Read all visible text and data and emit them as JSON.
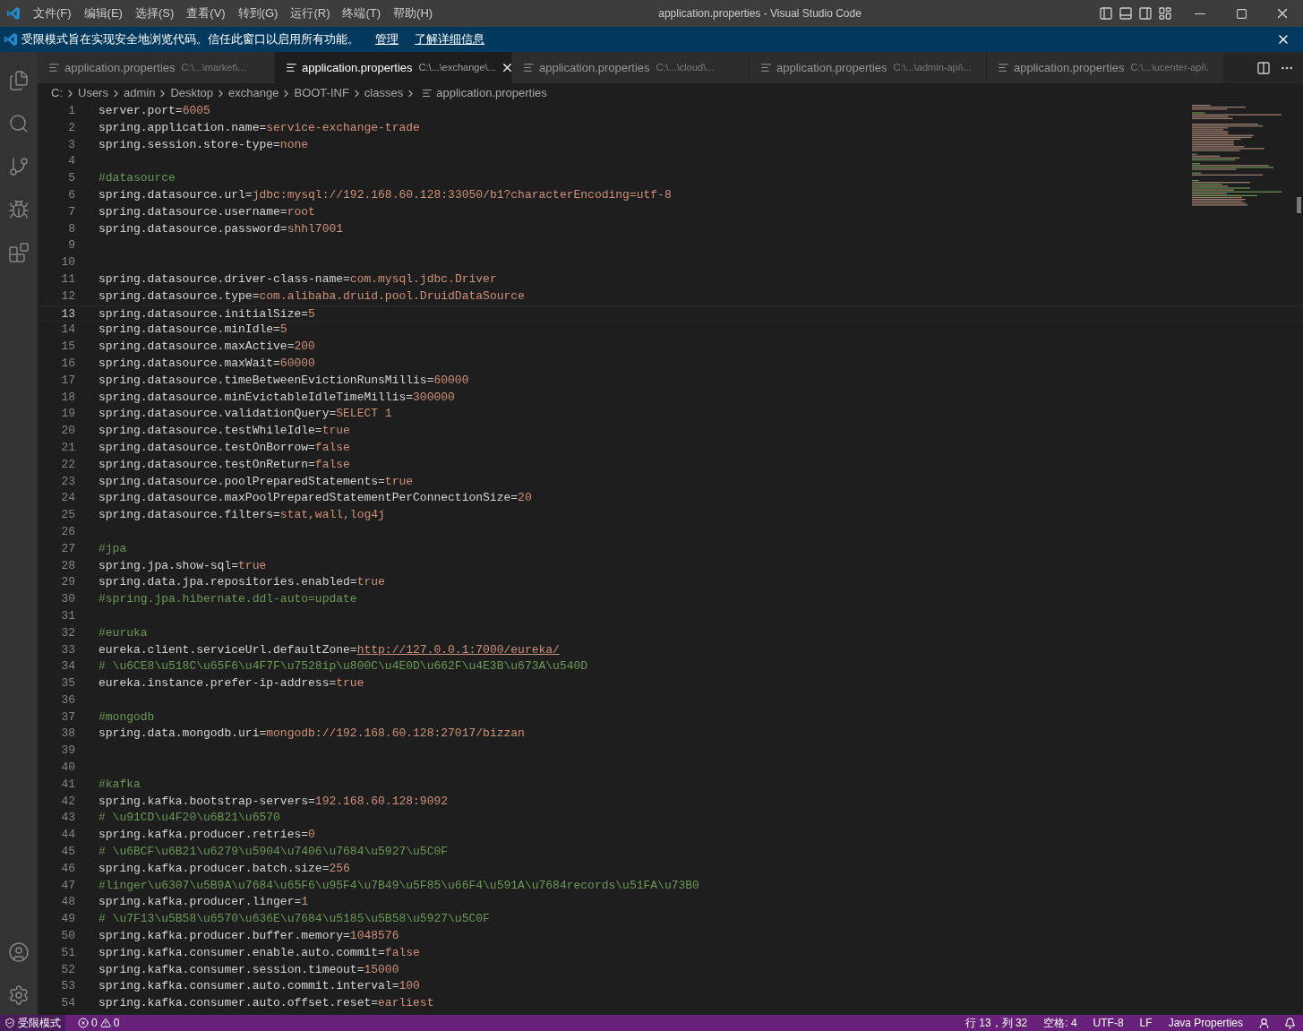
{
  "title_bar": {
    "menu": [
      "文件(F)",
      "编辑(E)",
      "选择(S)",
      "查看(V)",
      "转到(G)",
      "运行(R)",
      "终端(T)",
      "帮助(H)"
    ],
    "title": "application.properties - Visual Studio Code"
  },
  "banner": {
    "message": "受限模式旨在实现安全地浏览代码。信任此窗口以启用所有功能。",
    "links": [
      "管理",
      "了解详细信息"
    ]
  },
  "tabs": [
    {
      "label": "application.properties",
      "path": "C:\\...\\market\\...",
      "selected": false
    },
    {
      "label": "application.properties",
      "path": "C:\\...\\exchange\\...",
      "selected": true
    },
    {
      "label": "application.properties",
      "path": "C:\\...\\cloud\\...",
      "selected": false
    },
    {
      "label": "application.properties",
      "path": "C:\\...\\admin-api\\...",
      "selected": false
    },
    {
      "label": "application.properties",
      "path": "C:\\...\\ucenter-api\\.",
      "selected": false
    }
  ],
  "breadcrumb": [
    "C:",
    "Users",
    "admin",
    "Desktop",
    "exchange",
    "BOOT-INF",
    "classes",
    "application.properties"
  ],
  "editor": {
    "lines": [
      {
        "number": "1",
        "kind": "kv",
        "key": "server.port=",
        "value": "6005",
        "selected": false
      },
      {
        "number": "2",
        "kind": "kv",
        "key": "spring.application.name=",
        "value": "service-exchange-trade",
        "selected": false
      },
      {
        "number": "3",
        "kind": "kv",
        "key": "spring.session.store-type=",
        "value": "none",
        "selected": false
      },
      {
        "number": "4",
        "kind": "blank",
        "selected": false
      },
      {
        "number": "5",
        "kind": "comment",
        "text": "#datasource",
        "selected": false
      },
      {
        "number": "6",
        "kind": "kv",
        "key": "spring.datasource.url=",
        "value": "jdbc:mysql://192.168.60.128:33050/b1?characterEncoding=utf-8",
        "selected": false
      },
      {
        "number": "7",
        "kind": "kv",
        "key": "spring.datasource.username=",
        "value": "root",
        "selected": false
      },
      {
        "number": "8",
        "kind": "kv",
        "key": "spring.datasource.password=",
        "value": "shhl7001",
        "selected": false
      },
      {
        "number": "9",
        "kind": "blank",
        "selected": false
      },
      {
        "number": "10",
        "kind": "blank",
        "selected": false
      },
      {
        "number": "11",
        "kind": "kv",
        "key": "spring.datasource.driver-class-name=",
        "value": "com.mysql.jdbc.Driver",
        "selected": false
      },
      {
        "number": "12",
        "kind": "kv",
        "key": "spring.datasource.type=",
        "value": "com.alibaba.druid.pool.DruidDataSource",
        "selected": false
      },
      {
        "number": "13",
        "kind": "kv",
        "key": "spring.datasource.initialSize=",
        "value": "5",
        "selected": true
      },
      {
        "number": "14",
        "kind": "kv",
        "key": "spring.datasource.minIdle=",
        "value": "5",
        "selected": false
      },
      {
        "number": "15",
        "kind": "kv",
        "key": "spring.datasource.maxActive=",
        "value": "200",
        "selected": false
      },
      {
        "number": "16",
        "kind": "kv",
        "key": "spring.datasource.maxWait=",
        "value": "60000",
        "selected": false
      },
      {
        "number": "17",
        "kind": "kv",
        "key": "spring.datasource.timeBetweenEvictionRunsMillis=",
        "value": "60000",
        "selected": false
      },
      {
        "number": "18",
        "kind": "kv",
        "key": "spring.datasource.minEvictableIdleTimeMillis=",
        "value": "300000",
        "selected": false
      },
      {
        "number": "19",
        "kind": "kv",
        "key": "spring.datasource.validationQuery=",
        "value": "SELECT 1",
        "selected": false
      },
      {
        "number": "20",
        "kind": "kv",
        "key": "spring.datasource.testWhileIdle=",
        "value": "true",
        "selected": false
      },
      {
        "number": "21",
        "kind": "kv",
        "key": "spring.datasource.testOnBorrow=",
        "value": "false",
        "selected": false
      },
      {
        "number": "22",
        "kind": "kv",
        "key": "spring.datasource.testOnReturn=",
        "value": "false",
        "selected": false
      },
      {
        "number": "23",
        "kind": "kv",
        "key": "spring.datasource.poolPreparedStatements=",
        "value": "true",
        "selected": false
      },
      {
        "number": "24",
        "kind": "kv",
        "key": "spring.datasource.maxPoolPreparedStatementPerConnectionSize=",
        "value": "20",
        "selected": false
      },
      {
        "number": "25",
        "kind": "kv",
        "key": "spring.datasource.filters=",
        "value": "stat,wall,log4j",
        "selected": false
      },
      {
        "number": "26",
        "kind": "blank",
        "selected": false
      },
      {
        "number": "27",
        "kind": "comment",
        "text": "#jpa",
        "selected": false
      },
      {
        "number": "28",
        "kind": "kv",
        "key": "spring.jpa.show-sql=",
        "value": "true",
        "selected": false
      },
      {
        "number": "29",
        "kind": "kv",
        "key": "spring.data.jpa.repositories.enabled=",
        "value": "true",
        "selected": false
      },
      {
        "number": "30",
        "kind": "comment",
        "text": "#spring.jpa.hibernate.ddl-auto=update",
        "selected": false
      },
      {
        "number": "31",
        "kind": "blank",
        "selected": false
      },
      {
        "number": "32",
        "kind": "comment",
        "text": "#euruka",
        "selected": false
      },
      {
        "number": "33",
        "kind": "link",
        "key": "eureka.client.serviceUrl.defaultZone=",
        "value": "http://127.0.0.1:7000/eureka/",
        "selected": false
      },
      {
        "number": "34",
        "kind": "comment",
        "text": "# \\u6CE8\\u518C\\u65F6\\u4F7F\\u7528ip\\u800C\\u4E0D\\u662F\\u4E3B\\u673A\\u540D",
        "selected": false
      },
      {
        "number": "35",
        "kind": "kv",
        "key": "eureka.instance.prefer-ip-address=",
        "value": "true",
        "selected": false
      },
      {
        "number": "36",
        "kind": "blank",
        "selected": false
      },
      {
        "number": "37",
        "kind": "comment",
        "text": "#mongodb",
        "selected": false
      },
      {
        "number": "38",
        "kind": "kv",
        "key": "spring.data.mongodb.uri=",
        "value": "mongodb://192.168.60.128:27017/bizzan",
        "selected": false
      },
      {
        "number": "39",
        "kind": "blank",
        "selected": false
      },
      {
        "number": "40",
        "kind": "blank",
        "selected": false
      },
      {
        "number": "41",
        "kind": "comment",
        "text": "#kafka",
        "selected": false
      },
      {
        "number": "42",
        "kind": "kv",
        "key": "spring.kafka.bootstrap-servers=",
        "value": "192.168.60.128:9092",
        "selected": false
      },
      {
        "number": "43",
        "kind": "comment",
        "text": "# \\u91CD\\u4F20\\u6B21\\u6570",
        "selected": false
      },
      {
        "number": "44",
        "kind": "kv",
        "key": "spring.kafka.producer.retries=",
        "value": "0",
        "selected": false
      },
      {
        "number": "45",
        "kind": "comment",
        "text": "# \\u6BCF\\u6B21\\u6279\\u5904\\u7406\\u7684\\u5927\\u5C0F",
        "selected": false
      },
      {
        "number": "46",
        "kind": "kv",
        "key": "spring.kafka.producer.batch.size=",
        "value": "256",
        "selected": false
      },
      {
        "number": "47",
        "kind": "comment",
        "text": "#linger\\u6307\\u5B9A\\u7684\\u65F6\\u95F4\\u7B49\\u5F85\\u66F4\\u591A\\u7684records\\u51FA\\u73B0",
        "selected": false
      },
      {
        "number": "48",
        "kind": "kv",
        "key": "spring.kafka.producer.linger=",
        "value": "1",
        "selected": false
      },
      {
        "number": "49",
        "kind": "comment",
        "text": "# \\u7F13\\u5B58\\u6570\\u636E\\u7684\\u5185\\u5B58\\u5927\\u5C0F",
        "selected": false
      },
      {
        "number": "50",
        "kind": "kv",
        "key": "spring.kafka.producer.buffer.memory=",
        "value": "1048576",
        "selected": false
      },
      {
        "number": "51",
        "kind": "kv",
        "key": "spring.kafka.consumer.enable.auto.commit=",
        "value": "false",
        "selected": false
      },
      {
        "number": "52",
        "kind": "kv",
        "key": "spring.kafka.consumer.session.timeout=",
        "value": "15000",
        "selected": false
      },
      {
        "number": "53",
        "kind": "kv",
        "key": "spring.kafka.consumer.auto.commit.interval=",
        "value": "100",
        "selected": false
      },
      {
        "number": "54",
        "kind": "kv",
        "key": "spring.kafka.consumer.auto.offset.reset=",
        "value": "earliest",
        "selected": false
      }
    ]
  },
  "status_bar": {
    "mode": "受限模式",
    "errors": "0",
    "warnings": "0",
    "items": [
      "行 13，列 32",
      "空格: 4",
      "UTF-8",
      "LF",
      "Java Properties"
    ]
  }
}
